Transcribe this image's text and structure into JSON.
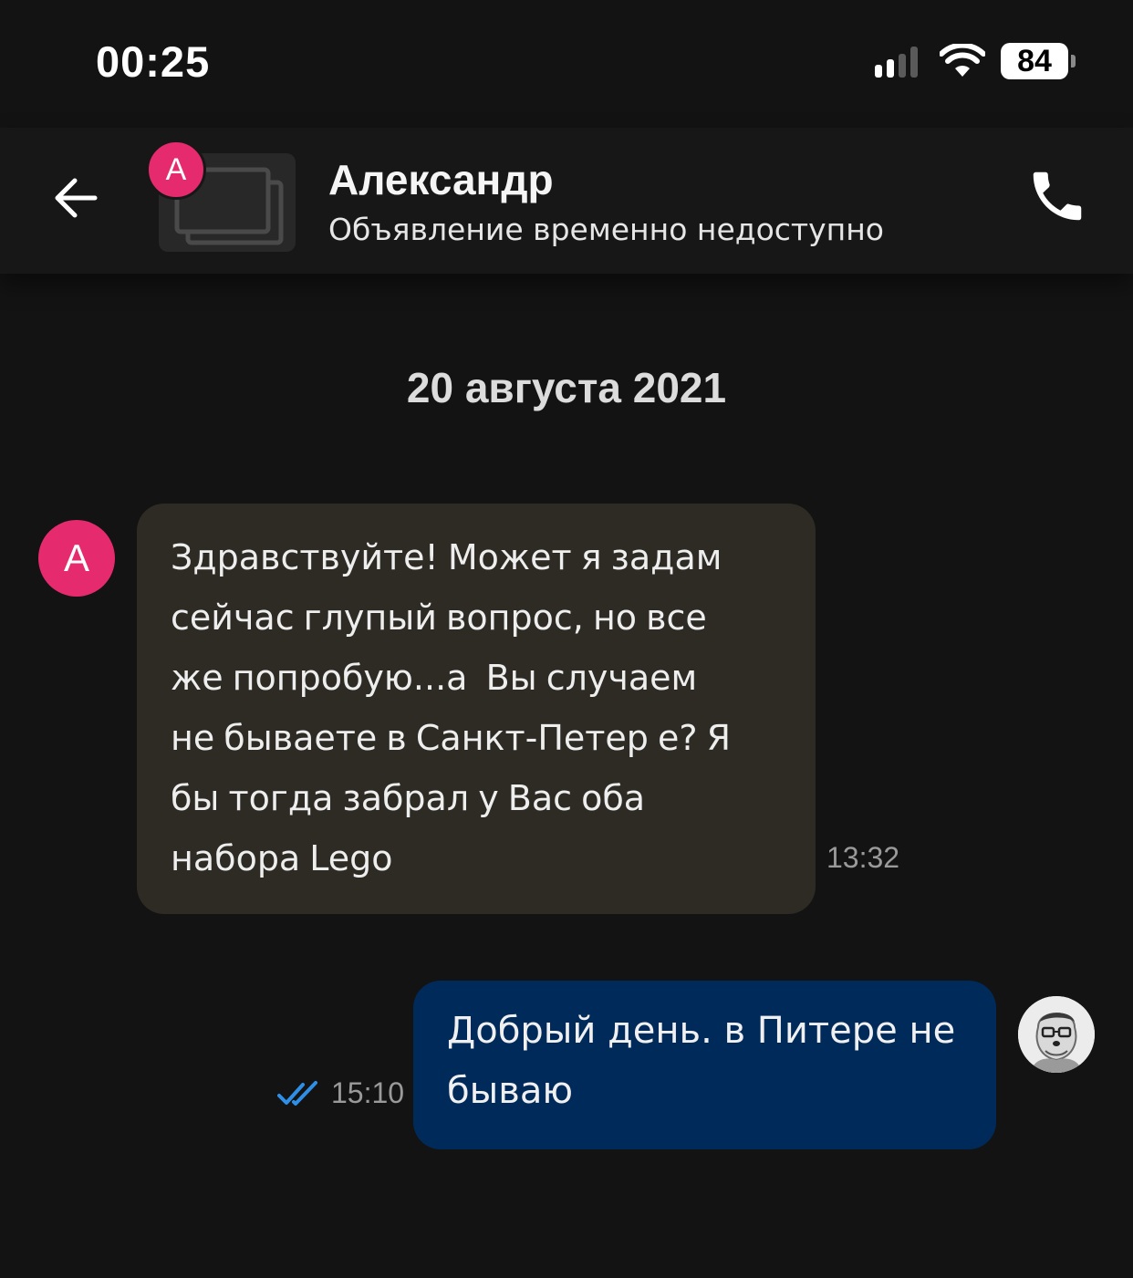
{
  "status_bar": {
    "time": "00:25",
    "battery": "84",
    "icons": [
      "signal-icon",
      "wifi-icon",
      "battery-icon"
    ]
  },
  "header": {
    "contact_name": "Александр",
    "listing_status": "Объявление временно недоступно",
    "avatar_letter": "A",
    "icons": [
      "back-arrow-icon",
      "image-placeholder-icon",
      "phone-icon"
    ]
  },
  "conversation": {
    "date": "20 августа 2021",
    "messages": [
      {
        "direction": "incoming",
        "avatar_letter": "A",
        "lines": [
          "Здравствуйте! Может я задам",
          "сейчас глупый вопрос, но все",
          "же попробую...а  Вы случаем",
          "не бываете в Санкт-Петер е? Я",
          "бы тогда забрал у Вас оба",
          "набора Lego"
        ],
        "time": "13:32"
      },
      {
        "direction": "outgoing",
        "lines": [
          "Добрый день. в Питере не",
          "бываю"
        ],
        "time": "15:10",
        "status_icon": "double-check-icon"
      }
    ]
  },
  "colors": {
    "background": "#131313",
    "header": "#171717",
    "incoming_bubble": "#2e2b24",
    "outgoing_bubble": "#002a5a",
    "avatar_pink": "#e52a6e",
    "read_check": "#2f8fe6"
  }
}
